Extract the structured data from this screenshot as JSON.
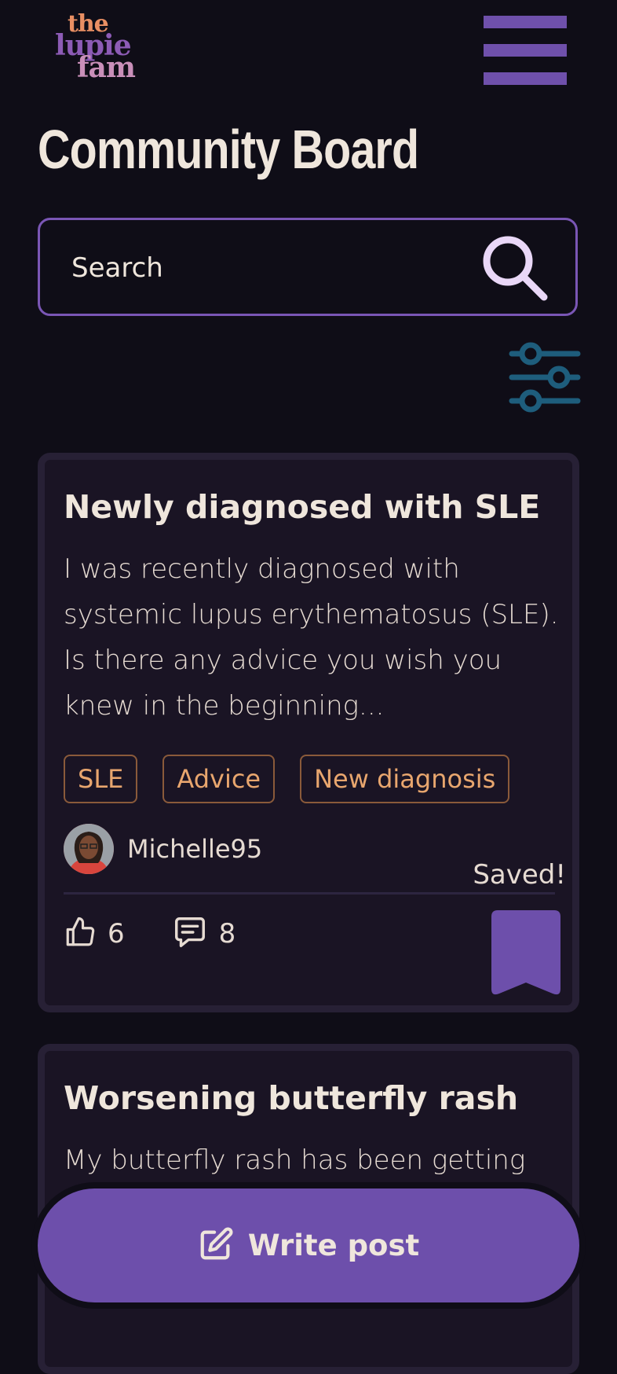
{
  "header": {
    "logo": {
      "line1": "the",
      "line2": "lupie",
      "line3": "fam"
    }
  },
  "page_title": "Community Board",
  "search": {
    "placeholder": "Search"
  },
  "posts": [
    {
      "title": "Newly diagnosed with SLE",
      "body": "I was recently diagnosed with systemic lupus erythematosus (SLE). Is there any advice you wish you knew in the beginning...",
      "tags": [
        "SLE",
        "Advice",
        "New diagnosis"
      ],
      "author": "Michelle95",
      "saved_label": "Saved!",
      "likes": "6",
      "comments": "8",
      "saved": true
    },
    {
      "title": "Worsening butterfly rash",
      "body": "My butterfly rash has been getting"
    }
  ],
  "write_post": {
    "label": "Write post"
  },
  "colors": {
    "background": "#0f0d17",
    "accent_purple": "#6d4fab",
    "card": "#1a1424",
    "tag_orange": "#e8a66e",
    "filter_teal": "#1e5d7c",
    "text": "#efe6dc"
  }
}
